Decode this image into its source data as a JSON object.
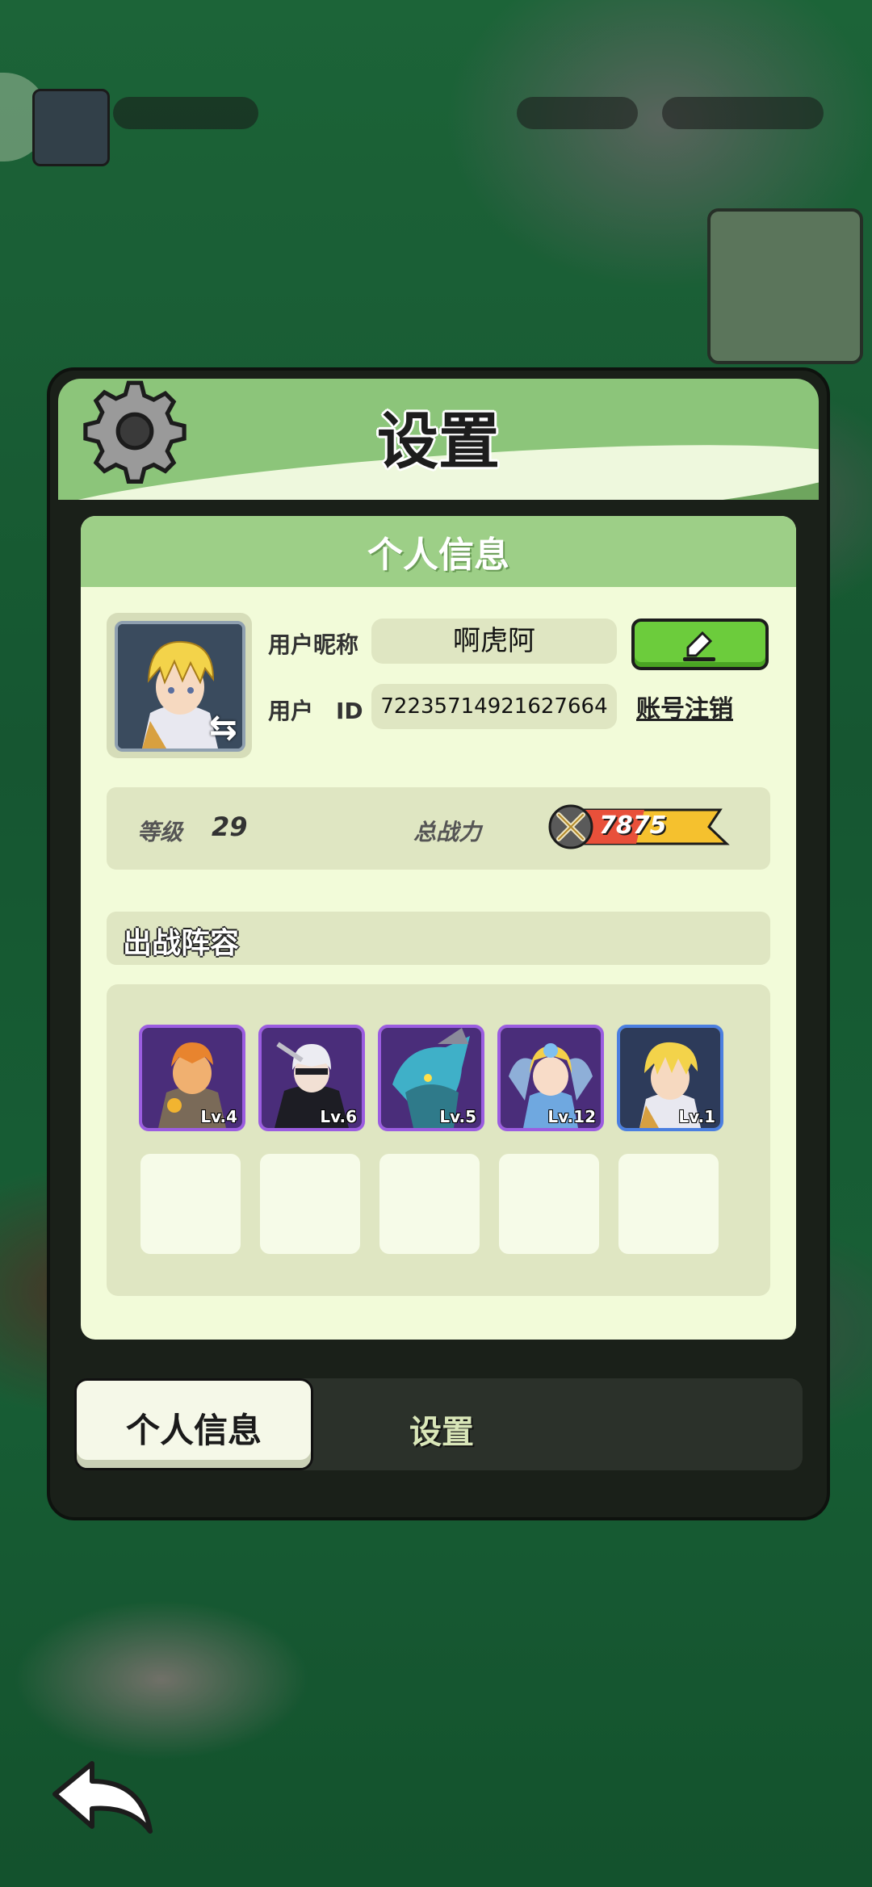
{
  "panel": {
    "title": "设置",
    "section_title": "个人信息"
  },
  "profile": {
    "nickname_label": "用户昵称",
    "nickname": "啊虎阿",
    "id_label": "用户　ID",
    "user_id": "72235714921627664",
    "cancel_account": "账号注销"
  },
  "stats": {
    "level_label": "等级",
    "level": "29",
    "power_label": "总战力",
    "power": "7875"
  },
  "lineup": {
    "title": "出战阵容",
    "heroes": [
      {
        "lv": "Lv.4",
        "frame": "purple"
      },
      {
        "lv": "Lv.6",
        "frame": "purple"
      },
      {
        "lv": "Lv.5",
        "frame": "purple"
      },
      {
        "lv": "Lv.12",
        "frame": "purple"
      },
      {
        "lv": "Lv.1",
        "frame": "blue"
      }
    ]
  },
  "tabs": {
    "profile": "个人信息",
    "settings": "设置"
  },
  "colors": {
    "accent_green": "#8cc57a",
    "edit_button": "#6ccc3c",
    "power_bar": "#f5c12e"
  },
  "icons": [
    "gear-icon",
    "pencil-icon",
    "swap-icon",
    "swords-icon",
    "back-arrow-icon"
  ]
}
